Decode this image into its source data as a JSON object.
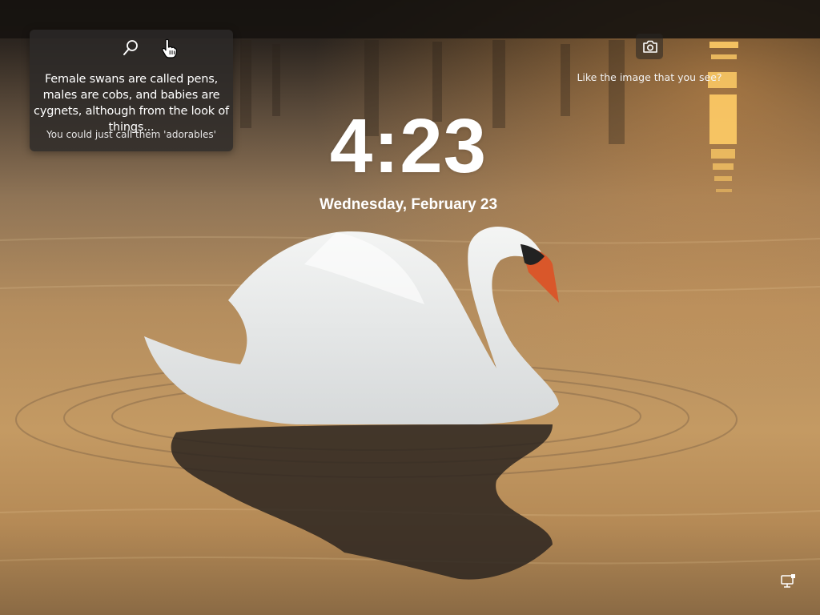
{
  "lock_screen": {
    "time": "4:23",
    "date": "Wednesday, February 23"
  },
  "spotlight": {
    "icon": "search-icon",
    "headline": "Female swans are called pens, males are cobs, and babies are cygnets, although from the look of things...",
    "subtext": "You could just call them 'adorables'"
  },
  "feedback": {
    "icon": "camera-icon",
    "prompt": "Like the image that you see?"
  },
  "status": {
    "network_icon": "network-icon"
  },
  "colors": {
    "water_warm": "#c49a63",
    "water_shadow": "#5b4a3a",
    "swan_white": "#eef0f0",
    "beak_orange": "#d9572a",
    "card_bg": "#2c2a28"
  }
}
